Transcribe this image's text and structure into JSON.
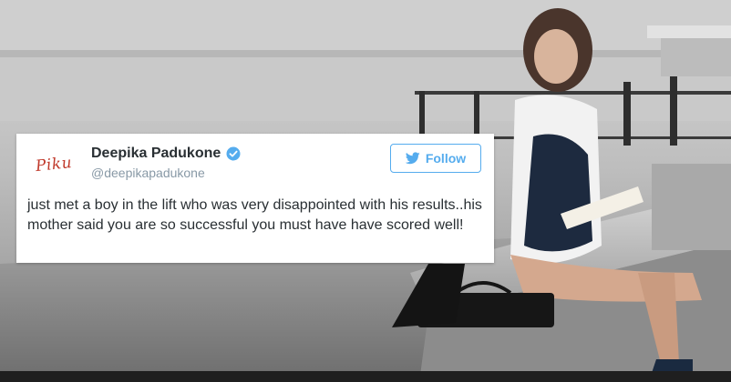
{
  "tweet": {
    "avatar_text": "Piku",
    "display_name": "Deepika Padukone",
    "handle": "@deepikapadukone",
    "verified": true,
    "follow_label": "Follow",
    "text": "just met a boy in the lift who was very disappointed with his results..his mother said you are so successful you must have have scored well!"
  },
  "colors": {
    "twitter_blue": "#55acee",
    "avatar_red": "#c0392b",
    "background_gray": "#9a9a9a"
  },
  "icons": {
    "verified": "verified-badge-icon",
    "follow": "twitter-bird-icon"
  }
}
